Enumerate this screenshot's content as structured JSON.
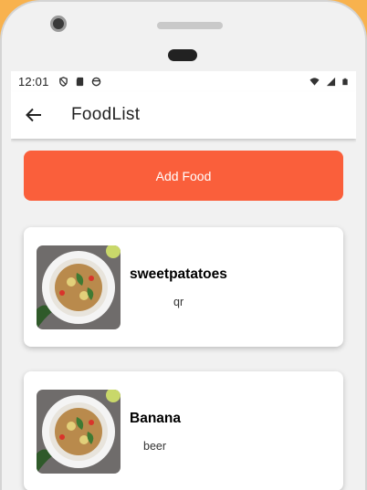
{
  "status_bar": {
    "time": "12:01",
    "left_icons": [
      "shield-icon",
      "sd-card-icon",
      "face-icon"
    ],
    "right_icons": [
      "wifi-icon",
      "signal-icon",
      "battery-icon"
    ]
  },
  "app_bar": {
    "back_icon": "arrow-left-icon",
    "title": "FoodList"
  },
  "add_button": {
    "label": "Add Food",
    "color": "#fa5f3b"
  },
  "foods": [
    {
      "name": "sweetpatatoes",
      "description": "qr",
      "image": "salad-plate-image"
    },
    {
      "name": "Banana",
      "description": "beer",
      "image": "salad-plate-image"
    }
  ]
}
